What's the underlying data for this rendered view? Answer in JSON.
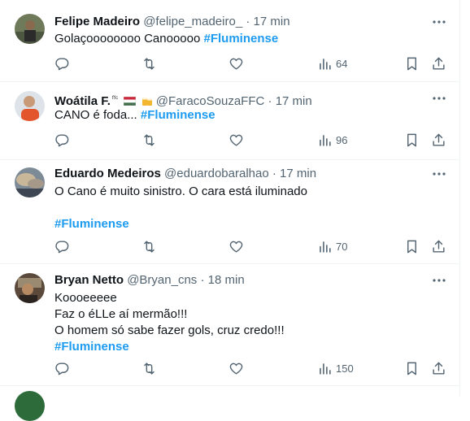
{
  "tweets": [
    {
      "name": "Felipe Madeiro",
      "handle": "@felipe_madeiro_",
      "time": "17 min",
      "lines": [
        "Golaçoooooooo Canooooo"
      ],
      "hashtag": "#Fluminense",
      "views": "64"
    },
    {
      "name": "Woátila F.",
      "name_suffix": "ᶠᶠᶜ",
      "handle": "@FaracoSouzaFFC",
      "time": "17 min",
      "lines": [
        "CANO é foda..."
      ],
      "hashtag": "#Fluminense",
      "views": "96"
    },
    {
      "name": "Eduardo Medeiros",
      "handle": "@eduardobaralhao",
      "time": "17 min",
      "lines": [
        "O Cano é muito sinistro. O cara está iluminado"
      ],
      "hashtag": "#Fluminense",
      "views": "70"
    },
    {
      "name": "Bryan Netto",
      "handle": "@Bryan_cns",
      "time": "18 min",
      "lines": [
        "Koooeeeee",
        "Faz o éLLe aí mermão!!!",
        "O homem só sabe fazer gols, cruz credo!!!"
      ],
      "hashtag": "#Fluminense",
      "views": "150"
    }
  ],
  "separator": "·",
  "colors": {
    "hashtag": "#1d9bf0",
    "muted": "#536471",
    "text": "#0f1419"
  },
  "icons": [
    "reply-icon",
    "retweet-icon",
    "like-icon",
    "views-icon",
    "bookmark-icon",
    "share-icon",
    "more-icon"
  ]
}
